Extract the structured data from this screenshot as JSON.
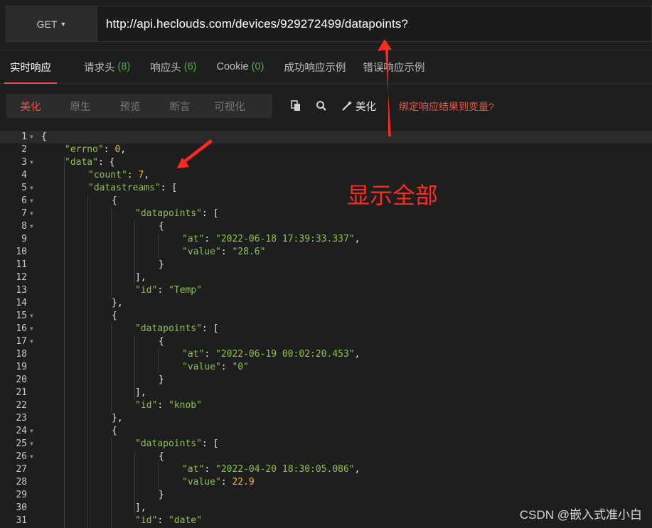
{
  "request": {
    "method": "GET",
    "url": "http://api.heclouds.com/devices/929272499/datapoints?"
  },
  "tabs": [
    {
      "label": "实时响应",
      "count": ""
    },
    {
      "label": "请求头",
      "count": "(8)"
    },
    {
      "label": "响应头",
      "count": "(6)"
    },
    {
      "label": "Cookie",
      "count": "(0)"
    },
    {
      "label": "成功响应示例",
      "count": ""
    },
    {
      "label": "错误响应示例",
      "count": ""
    }
  ],
  "view_modes": [
    "美化",
    "原生",
    "预览",
    "断言",
    "可视化"
  ],
  "toolbar": {
    "copy_icon": "copy-icon",
    "search_icon": "search-icon",
    "beautify_label": "美化",
    "bind_label": "绑定响应结果到变量?"
  },
  "code_lines": [
    {
      "n": "1",
      "fold": true
    },
    {
      "n": "2"
    },
    {
      "n": "3",
      "fold": true
    },
    {
      "n": "4"
    },
    {
      "n": "5",
      "fold": true
    },
    {
      "n": "6",
      "fold": true
    },
    {
      "n": "7",
      "fold": true
    },
    {
      "n": "8",
      "fold": true
    },
    {
      "n": "9"
    },
    {
      "n": "10"
    },
    {
      "n": "11"
    },
    {
      "n": "12"
    },
    {
      "n": "13"
    },
    {
      "n": "14"
    },
    {
      "n": "15",
      "fold": true
    },
    {
      "n": "16",
      "fold": true
    },
    {
      "n": "17",
      "fold": true
    },
    {
      "n": "18"
    },
    {
      "n": "19"
    },
    {
      "n": "20"
    },
    {
      "n": "21"
    },
    {
      "n": "22"
    },
    {
      "n": "23"
    },
    {
      "n": "24",
      "fold": true
    },
    {
      "n": "25",
      "fold": true
    },
    {
      "n": "26",
      "fold": true
    },
    {
      "n": "27"
    },
    {
      "n": "28"
    },
    {
      "n": "29"
    },
    {
      "n": "30"
    },
    {
      "n": "31"
    }
  ],
  "json_text": {
    "errno_key": "\"errno\"",
    "errno_val": "0",
    "data_key": "\"data\"",
    "count_key": "\"count\"",
    "count_val": "7",
    "datastreams_key": "\"datastreams\"",
    "datapoints_key": "\"datapoints\"",
    "at_key": "\"at\"",
    "value_key": "\"value\"",
    "id_key": "\"id\"",
    "at_1": "\"2022-06-18 17:39:33.337\"",
    "value_1": "\"28.6\"",
    "id_1": "\"Temp\"",
    "at_2": "\"2022-06-19 00:02:20.453\"",
    "value_2": "\"0\"",
    "id_2": "\"knob\"",
    "at_3": "\"2022-04-20 18:30:05.086\"",
    "value_3": "22.9",
    "id_3": "\"date\""
  },
  "annotation": {
    "text": "显示全部",
    "color": "#ff2a1f"
  },
  "watermark": "CSDN @嵌入式准小白",
  "colors": {
    "accent": "#d9534f",
    "key": "#8bc34a",
    "number": "#f5b731"
  }
}
